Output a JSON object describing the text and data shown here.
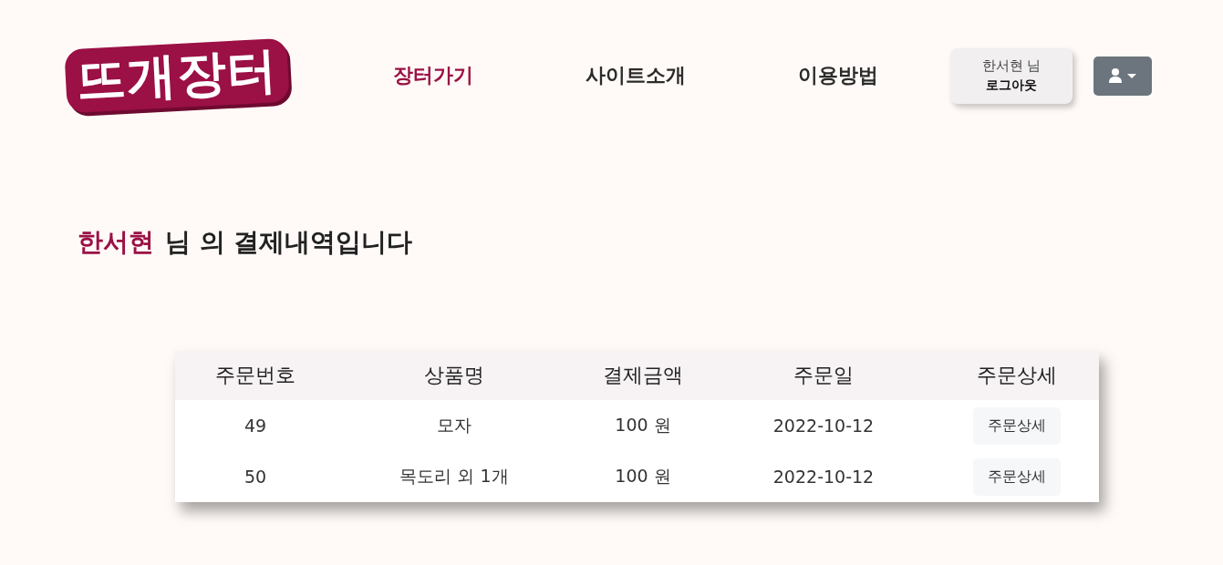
{
  "logo": {
    "text": "뜨개장터"
  },
  "nav": [
    {
      "label": "장터가기",
      "selected": true
    },
    {
      "label": "사이트소개",
      "selected": false
    },
    {
      "label": "이용방법",
      "selected": false
    }
  ],
  "user_panel": {
    "greeting": "한서현 님",
    "logout": "로그아웃"
  },
  "heading": {
    "name": "한서현",
    "text": "님 의 결제내역입니다"
  },
  "table": {
    "columns": [
      "주문번호",
      "상품명",
      "결제금액",
      "주문일",
      "주문상세"
    ],
    "rows": [
      {
        "order_no": "49",
        "product": "모자",
        "amount": "100 원",
        "date": "2022-10-12",
        "detail": "주문상세"
      },
      {
        "order_no": "50",
        "product": "목도리 외 1개",
        "amount": "100 원",
        "date": "2022-10-12",
        "detail": "주문상세"
      }
    ]
  }
}
